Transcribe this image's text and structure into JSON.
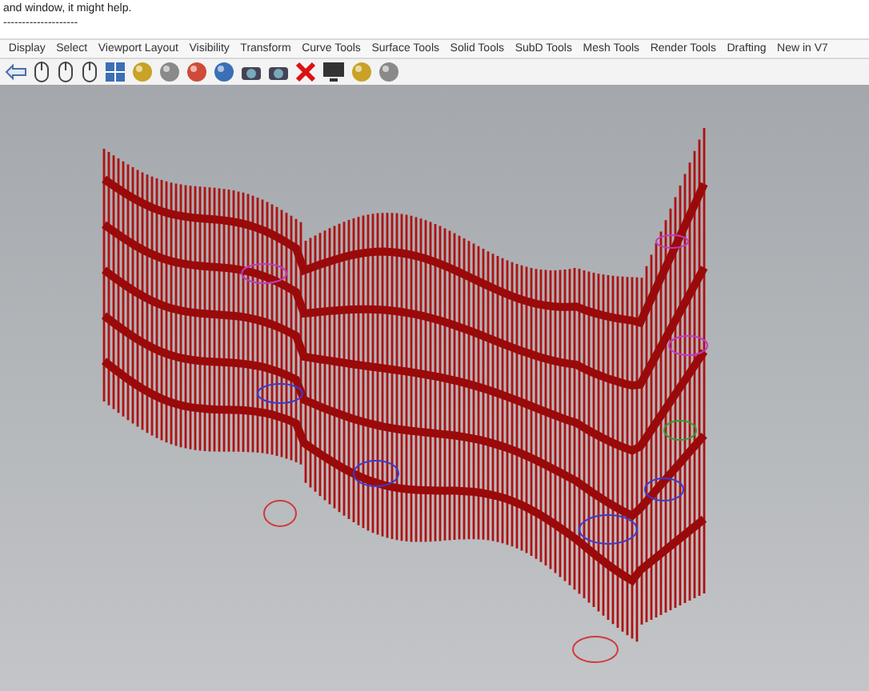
{
  "command_area": {
    "lines": [
      "and window, it might help.",
      "--------------------"
    ]
  },
  "tabs": [
    {
      "label": "Display",
      "selected": false
    },
    {
      "label": "Select",
      "selected": false
    },
    {
      "label": "Viewport Layout",
      "selected": false
    },
    {
      "label": "Visibility",
      "selected": false
    },
    {
      "label": "Transform",
      "selected": false
    },
    {
      "label": "Curve Tools",
      "selected": false
    },
    {
      "label": "Surface Tools",
      "selected": false
    },
    {
      "label": "Solid Tools",
      "selected": false
    },
    {
      "label": "SubD Tools",
      "selected": false
    },
    {
      "label": "Mesh Tools",
      "selected": false
    },
    {
      "label": "Render Tools",
      "selected": false
    },
    {
      "label": "Drafting",
      "selected": false
    },
    {
      "label": "New in V7",
      "selected": false
    }
  ],
  "toolbar": {
    "tools": [
      {
        "kind": "pan"
      },
      {
        "kind": "mouse"
      },
      {
        "kind": "mouse"
      },
      {
        "kind": "mouse"
      },
      {
        "kind": "viewports"
      },
      {
        "kind": "sphere"
      },
      {
        "kind": "sphere"
      },
      {
        "kind": "sphere"
      },
      {
        "kind": "sphere"
      },
      {
        "kind": "camera"
      },
      {
        "kind": "camera"
      },
      {
        "kind": "cross"
      },
      {
        "kind": "monitor"
      },
      {
        "kind": "sphere"
      },
      {
        "kind": "sphere"
      }
    ]
  }
}
